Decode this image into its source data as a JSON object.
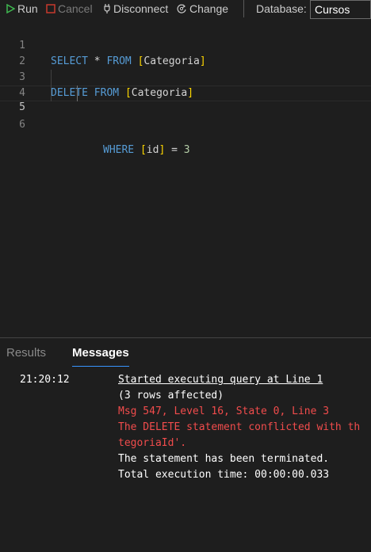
{
  "toolbar": {
    "run_label": "Run",
    "cancel_label": "Cancel",
    "disconnect_label": "Disconnect",
    "change_label": "Change",
    "database_label": "Database:",
    "database_value": "Cursos",
    "colors": {
      "run_icon": "#3fb950",
      "cancel_icon": "#c7392d"
    }
  },
  "editor": {
    "line_numbers": [
      "1",
      "2",
      "3",
      "4",
      "5",
      "6"
    ],
    "active_line": "5",
    "lines": [
      {
        "kw1": "SELECT",
        "op": "*",
        "kw2": "FROM",
        "ob": "[",
        "name": "Categoria",
        "cb": "]"
      },
      {},
      {
        "kw1": "DELETE",
        "kw2": "FROM",
        "ob": "[",
        "name": "Categoria",
        "cb": "]"
      },
      {},
      {
        "kw1": "WHERE",
        "ob": "[",
        "name": "id",
        "cb": "]",
        "op": "=",
        "num": "3"
      },
      {}
    ]
  },
  "results_panel": {
    "tabs": [
      {
        "label": "Results",
        "active": false
      },
      {
        "label": "Messages",
        "active": true
      }
    ],
    "timestamp": "21:20:12",
    "messages": [
      {
        "text": "Started executing query at Line 1",
        "type": "link"
      },
      {
        "text": "(3 rows affected)",
        "type": "info"
      },
      {
        "text": "Msg 547, Level 16, State 0, Line 3",
        "type": "error"
      },
      {
        "text": "The DELETE statement conflicted with th",
        "type": "error"
      },
      {
        "text": "tegoriaId'.",
        "type": "error"
      },
      {
        "text": "The statement has been terminated.",
        "type": "info"
      },
      {
        "text": "Total execution time: 00:00:00.033",
        "type": "info"
      }
    ]
  }
}
